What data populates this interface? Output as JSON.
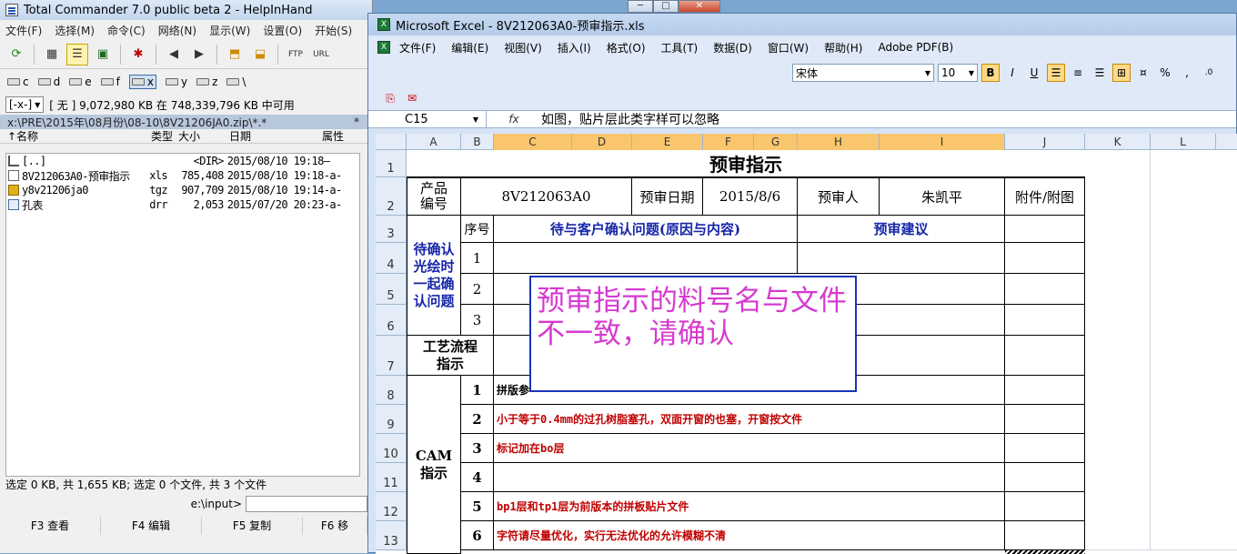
{
  "tc": {
    "title": "Total Commander 7.0 public beta 2 - HelpInHand",
    "menu": [
      "文件(F)",
      "选择(M)",
      "命令(C)",
      "网络(N)",
      "显示(W)",
      "设置(O)",
      "开始(S)"
    ],
    "drives": [
      "c",
      "d",
      "e",
      "f",
      "x",
      "y",
      "z",
      "\\"
    ],
    "drive_selected": "x",
    "drive_combo": "[-x-]",
    "drive_info": "[ 无 ]  9,072,980 KB 在 748,339,796 KB 中可用",
    "path": "x:\\PRE\\2015年\\08月份\\08-10\\8V21206JA0.zip\\*.*",
    "path_right": "*",
    "columns": {
      "name": "↑名称",
      "type": "类型",
      "size": "大小",
      "date": "日期",
      "attr": "属性"
    },
    "files": [
      {
        "name": "[..]",
        "type": "",
        "size": "<DIR>",
        "date": "2015/08/10 19:18—",
        "icon": "up-folder-icon"
      },
      {
        "name": "8V212063A0-预审指示",
        "type": "xls",
        "size": "785,408",
        "date": "2015/08/10 19:18-a-",
        "icon": "xls-file-icon"
      },
      {
        "name": "y8v21206ja0",
        "type": "tgz",
        "size": "907,709",
        "date": "2015/08/10 19:14-a-",
        "icon": "archive-icon"
      },
      {
        "name": "孔表",
        "type": "drr",
        "size": "2,053",
        "date": "2015/07/20 20:23-a-",
        "icon": "document-icon"
      }
    ],
    "status": "选定 0 KB, 共 1,655 KB; 选定 0 个文件, 共 3 个文件",
    "cmd_prompt": "e:\\input>",
    "fkeys": [
      "F3 查看",
      "F4 编辑",
      "F5 复制",
      "F6 移"
    ]
  },
  "excel": {
    "title": "Microsoft Excel - 8V212063A0-预审指示.xls",
    "menu": [
      "文件(F)",
      "编辑(E)",
      "视图(V)",
      "插入(I)",
      "格式(O)",
      "工具(T)",
      "数据(D)",
      "窗口(W)",
      "帮助(H)",
      "Adobe PDF(B)"
    ],
    "font": "宋体",
    "font_size": "10",
    "name_box": "C15",
    "fx": "fx",
    "formula": "如图，贴片层此类字样可以忽略",
    "columns": [
      "A",
      "B",
      "C",
      "D",
      "E",
      "F",
      "G",
      "H",
      "I",
      "J",
      "K",
      "L"
    ],
    "rows": [
      "1",
      "2",
      "3",
      "4",
      "5",
      "6",
      "7",
      "8",
      "9",
      "10",
      "11",
      "12",
      "13"
    ],
    "sheet": {
      "title": "预审指示",
      "product_label": "产品\n编号",
      "product_no": "8V212063A0",
      "review_date_label": "预审日期",
      "review_date": "2015/8/6",
      "reviewer_label": "预审人",
      "reviewer": "朱凯平",
      "attachment_label": "附件/附图",
      "seq_label": "序号",
      "issues_label": "待与客户确认问题(原因与内容)",
      "suggest_label": "预审建议",
      "pending_label": "待确认\n光绘时\n一起确\n认问题",
      "n1": "1",
      "n2": "2",
      "n3": "3",
      "process_label": "工艺流程\n指示",
      "cam_label": "CAM\n指示",
      "cam_items": [
        {
          "n": "1",
          "text": "拼版参"
        },
        {
          "n": "2",
          "text": "小于等于0.4mm的过孔树脂塞孔，双面开窗的也塞，开窗按文件"
        },
        {
          "n": "3",
          "text": "标记加在bo层"
        },
        {
          "n": "4",
          "text": ""
        },
        {
          "n": "5",
          "text": "bp1层和tp1层为前版本的拼板贴片文件"
        },
        {
          "n": "6",
          "text": "字符请尽量优化，实行无法优化的允许模糊不清"
        }
      ]
    },
    "popup_text": "预审指示的料号名与文件不一致，请确认"
  }
}
